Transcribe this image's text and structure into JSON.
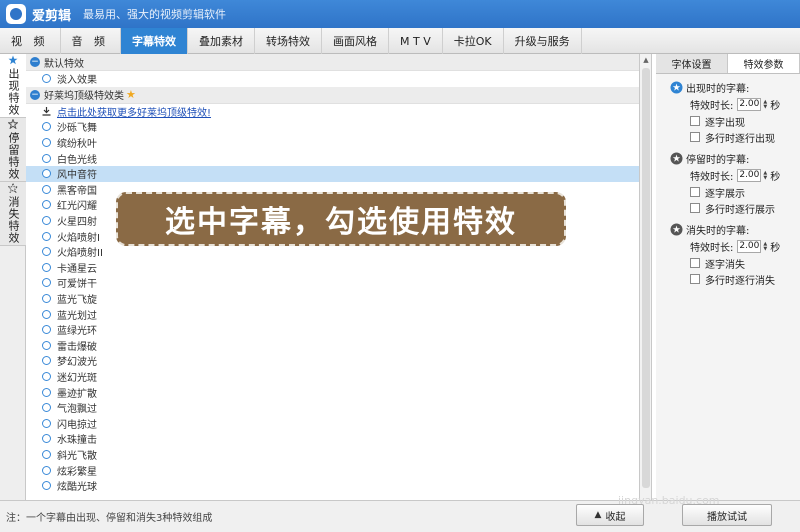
{
  "app": {
    "title": "爱剪辑",
    "subtitle": "最易用、强大的视频剪辑软件"
  },
  "main_tabs": [
    {
      "label": "视 频"
    },
    {
      "label": "音 频"
    },
    {
      "label": "字幕特效",
      "active": true
    },
    {
      "label": "叠加素材"
    },
    {
      "label": "转场特效"
    },
    {
      "label": "画面风格"
    },
    {
      "label": "M T V"
    },
    {
      "label": "卡拉OK"
    },
    {
      "label": "升级与服务"
    }
  ],
  "side_tabs": [
    {
      "label": "出现特效",
      "icon": "appear-star-icon",
      "active": true
    },
    {
      "label": "停留特效",
      "icon": "stay-icon"
    },
    {
      "label": "消失特效",
      "icon": "disappear-icon"
    }
  ],
  "effects": {
    "default_category": "默认特效",
    "default_items": [
      "淡入效果"
    ],
    "hollywood_category": "好莱坞顶级特效类",
    "promo_link": "点击此处获取更多好莱坞顶级特效!",
    "hollywood_items": [
      "沙砾飞舞",
      "缤纷秋叶",
      "白色光线",
      "风中音符",
      "黑客帝国",
      "红光闪耀",
      "火星四射",
      "火焰喷射I",
      "火焰喷射II",
      "卡通星云",
      "可爱饼干",
      "蓝光飞旋",
      "蓝光划过",
      "蓝绿光环",
      "雷击爆破",
      "梦幻波光",
      "迷幻光斑",
      "墨迹扩散",
      "气泡飘过",
      "闪电掠过",
      "水珠撞击",
      "斜光飞散",
      "炫彩繁星",
      "炫酷光球"
    ],
    "selected_item": "风中音符"
  },
  "caption": {
    "text": "选中字幕，勾选使用特效",
    "background": "#8a6a45"
  },
  "settings": {
    "tabs": [
      {
        "label": "字体设置"
      },
      {
        "label": "特效参数",
        "active": true
      }
    ],
    "duration_label": "特效时长:",
    "seconds_unit": "秒",
    "sections": [
      {
        "title": "出现时的字幕:",
        "duration": "2.00",
        "options": [
          "逐字出现",
          "多行时逐行出现"
        ],
        "icon": "appear-star-icon"
      },
      {
        "title": "停留时的字幕:",
        "duration": "2.00",
        "options": [
          "逐字展示",
          "多行时逐行展示"
        ],
        "icon": "stay-icon"
      },
      {
        "title": "消失时的字幕:",
        "duration": "2.00",
        "options": [
          "逐字消失",
          "多行时逐行消失"
        ],
        "icon": "disappear-icon"
      }
    ]
  },
  "bottom": {
    "note": "注：一个字幕由出现、停留和消失3种特效组成",
    "collapse_label": "收起",
    "play_label": "播放试试",
    "watermark": "jingyan.baidu.com"
  },
  "colors": {
    "accent": "#2f84d3",
    "selected_row": "#c4dff6"
  }
}
